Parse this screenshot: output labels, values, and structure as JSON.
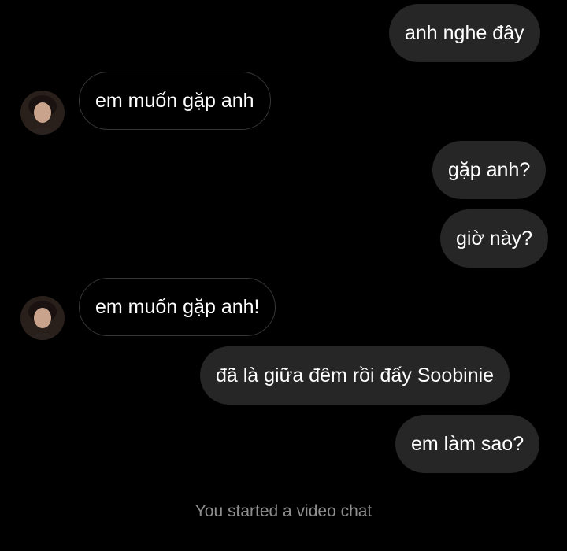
{
  "conversation": {
    "messages": [
      {
        "sender": "me",
        "text": "anh nghe đây"
      },
      {
        "sender": "them",
        "text": "em muốn gặp anh"
      },
      {
        "sender": "me",
        "text": "gặp anh?"
      },
      {
        "sender": "me",
        "text": "giờ này?"
      },
      {
        "sender": "them",
        "text": "em muốn gặp anh!"
      },
      {
        "sender": "me",
        "text": "đã là giữa đêm rồi đấy Soobinie"
      },
      {
        "sender": "me",
        "text": "em làm sao?"
      }
    ],
    "system_message": "You started a video chat"
  },
  "colors": {
    "background": "#000000",
    "outgoing_bubble": "#262626",
    "incoming_bubble_border": "#363636",
    "message_text": "#ffffff",
    "system_text": "#8e8e8e"
  },
  "icons": {
    "contact_avatar": "profile-photo"
  }
}
